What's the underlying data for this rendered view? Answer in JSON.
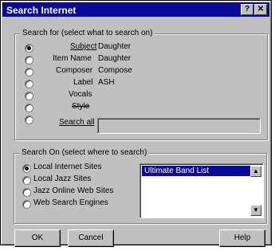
{
  "window": {
    "title": "Search Internet",
    "help_glyph": "?",
    "close_glyph": "✕"
  },
  "search_for": {
    "legend": "Search for (select what to search on)",
    "options": [
      {
        "label": "Subject",
        "value": "Daughter",
        "selected": true
      },
      {
        "label": "Item Name",
        "value": "Daughter",
        "selected": false
      },
      {
        "label": "Composer",
        "value": "Compose",
        "selected": false
      },
      {
        "label": "Label",
        "value": "ASH",
        "selected": false
      },
      {
        "label": "Vocals",
        "value": "",
        "selected": false
      },
      {
        "label": "Style",
        "value": "",
        "selected": false
      },
      {
        "label": "Search all",
        "value": "",
        "selected": false
      }
    ]
  },
  "search_on": {
    "legend": "Search On (select where to search)",
    "options": [
      {
        "label": "Local Internet Sites",
        "selected": true
      },
      {
        "label": "Local Jazz Sites",
        "selected": false
      },
      {
        "label": "Jazz Online Web Sites",
        "selected": false
      },
      {
        "label": "Web Search Engines",
        "selected": false
      }
    ],
    "list_selected": "Ultimate Band List",
    "scroll_up_glyph": "▲",
    "scroll_down_glyph": "▼"
  },
  "buttons": {
    "ok": "OK",
    "cancel": "Cancel",
    "help": "Help"
  }
}
